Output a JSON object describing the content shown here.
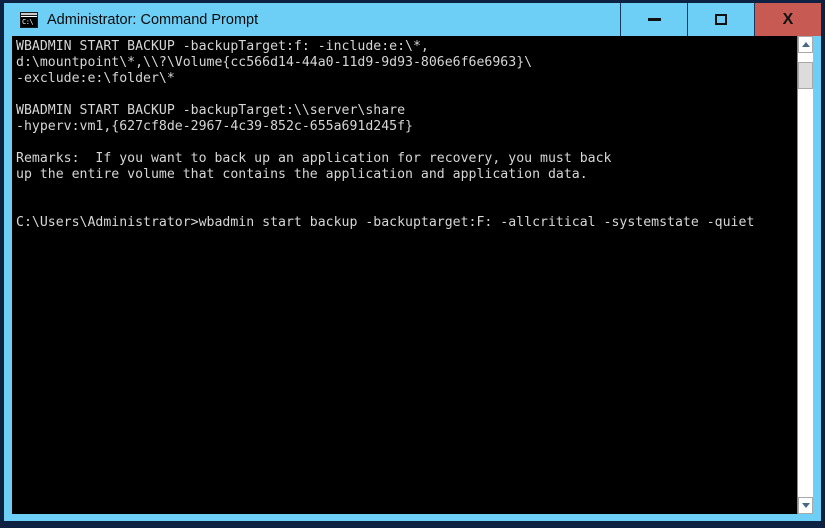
{
  "window": {
    "title": "Administrator: Command Prompt",
    "icon": "command-prompt-icon",
    "icon_text": "C:\\",
    "colors": {
      "titlebar": "#6dcff6",
      "close_button": "#c75b54",
      "console_background": "#000000",
      "console_foreground": "#d6d6d6",
      "desktop": "#0d2242"
    }
  },
  "title_buttons": {
    "minimize": "minimize",
    "maximize": "maximize",
    "close": "X"
  },
  "console": {
    "lines": [
      "WBADMIN START BACKUP -backupTarget:f: -include:e:\\*,",
      "d:\\mountpoint\\*,\\\\?\\Volume{cc566d14-44a0-11d9-9d93-806e6f6e6963}\\",
      "-exclude:e:\\folder\\*",
      "",
      "WBADMIN START BACKUP -backupTarget:\\\\server\\share",
      "-hyperv:vm1,{627cf8de-2967-4c39-852c-655a691d245f}",
      "",
      "Remarks:  If you want to back up an application for recovery, you must back",
      "up the entire volume that contains the application and application data.",
      "",
      "",
      "C:\\Users\\Administrator>wbadmin start backup -backuptarget:F: -allcritical -systemstate -quiet"
    ],
    "text": "WBADMIN START BACKUP -backupTarget:f: -include:e:\\*,\nd:\\mountpoint\\*,\\\\?\\Volume{cc566d14-44a0-11d9-9d93-806e6f6e6963}\\\n-exclude:e:\\folder\\*\n\nWBADMIN START BACKUP -backupTarget:\\\\server\\share\n-hyperv:vm1,{627cf8de-2967-4c39-852c-655a691d245f}\n\nRemarks:  If you want to back up an application for recovery, you must back\nup the entire volume that contains the application and application data.\n\n\nC:\\Users\\Administrator>wbadmin start backup -backuptarget:F: -allcritical -systemstate -quiet",
    "prompt": "C:\\Users\\Administrator>",
    "command": "wbadmin start backup -backuptarget:F: -allcritical -systemstate -quiet"
  },
  "scrollbar": {
    "up_arrow": "scroll-up",
    "down_arrow": "scroll-down",
    "thumb": "scroll-thumb"
  }
}
